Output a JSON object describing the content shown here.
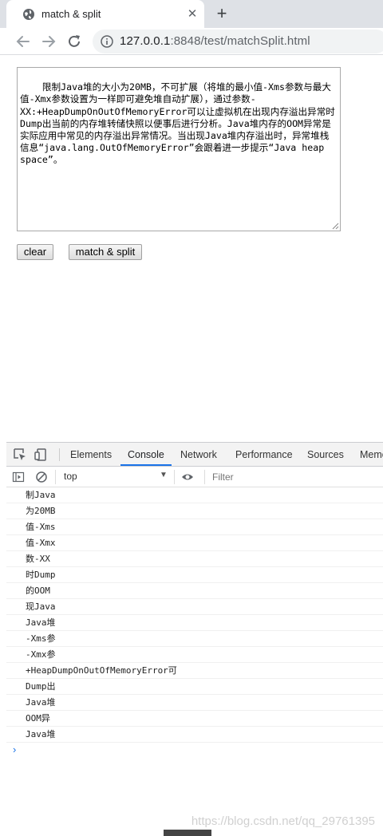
{
  "browser": {
    "tab": {
      "title": "match & split",
      "icon": "globe-icon",
      "close": "✕"
    },
    "new_tab": "+",
    "url_host": "127.0.0.1",
    "url_rest": ":8848/test/matchSplit.html"
  },
  "page": {
    "textarea_value": "限制Java堆的大小为20MB，不可扩展（将堆的最小值-Xms参数与最大值-Xmx参数设置为一样即可避免堆自动扩展），通过参数-XX:+HeapDumpOnOutOfMemoryError可以让虚拟机在出现内存溢出异常时Dump出当前的内存堆转储快照以便事后进行分析。Java堆内存的OOM异常是实际应用中常见的内存溢出异常情况。当出现Java堆内存溢出时，异常堆栈信息“java.lang.OutOfMemoryError”会跟着进一步提示“Java heap space”。",
    "clear_label": "clear",
    "match_label": "match & split"
  },
  "devtools": {
    "tabs": [
      "Elements",
      "Console",
      "Network",
      "Performance",
      "Sources",
      "Memo"
    ],
    "active_tab": "Console",
    "context": "top",
    "filter_placeholder": "Filter",
    "log": [
      "制Java",
      "为20MB",
      "值-Xms",
      "值-Xmx",
      "数-XX",
      "时Dump",
      "的OOM",
      "现Java",
      "Java堆",
      "-Xms参",
      "-Xmx参",
      "+HeapDumpOnOutOfMemoryError可",
      "Dump出",
      "Java堆",
      "OOM异",
      "Java堆"
    ],
    "prompt": "›"
  },
  "watermark": "https://blog.csdn.net/qq_29761395",
  "colors": {
    "accent": "#1a73e8",
    "tabstrip": "#dee1e6",
    "omnibox": "#f1f3f4"
  }
}
